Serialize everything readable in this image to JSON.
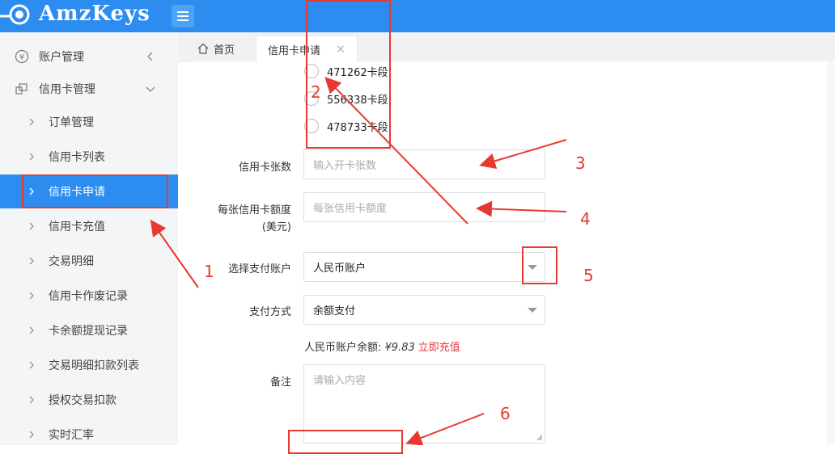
{
  "app": {
    "title": "AmzKeys"
  },
  "sidebar": {
    "groups": [
      {
        "label": "账户管理",
        "icon": "yen-icon",
        "expanded": false
      },
      {
        "label": "信用卡管理",
        "icon": "card-stack-icon",
        "expanded": true
      }
    ],
    "items": [
      {
        "label": "订单管理"
      },
      {
        "label": "信用卡列表"
      },
      {
        "label": "信用卡申请",
        "active": true
      },
      {
        "label": "信用卡充值"
      },
      {
        "label": "交易明细"
      },
      {
        "label": "信用卡作废记录"
      },
      {
        "label": "卡余额提现记录"
      },
      {
        "label": "交易明细扣款列表"
      },
      {
        "label": "授权交易扣款"
      },
      {
        "label": "实时汇率"
      }
    ]
  },
  "tabs": [
    {
      "label": "首页",
      "icon": "home-icon"
    },
    {
      "label": "信用卡申请",
      "active": true,
      "closable": true
    }
  ],
  "form": {
    "card_segments": [
      "471262卡段",
      "556338卡段",
      "478733卡段"
    ],
    "card_count": {
      "label": "信用卡张数",
      "placeholder": "输入开卡张数"
    },
    "card_limit": {
      "label": "每张信用卡额度",
      "label_unit": "(美元)",
      "placeholder": "每张信用卡额度"
    },
    "pay_account": {
      "label": "选择支付账户",
      "value": "人民币账户"
    },
    "pay_method": {
      "label": "支付方式",
      "value": "余额支付"
    },
    "balance": {
      "text": "人民币账户余额: ",
      "amount": "¥9.83",
      "link": "立即充值"
    },
    "remark": {
      "label": "备注",
      "placeholder": "请输入内容"
    }
  },
  "annotations": {
    "numbers": [
      "1",
      "2",
      "3",
      "4",
      "5",
      "6"
    ],
    "color": "#e63a30"
  },
  "colors": {
    "primary": "#2d8cf0",
    "annotation": "#e63a30",
    "link": "#e4393c"
  }
}
